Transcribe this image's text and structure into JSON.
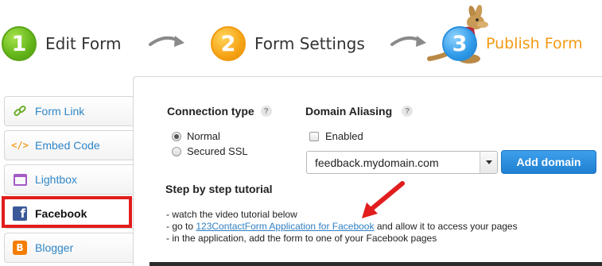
{
  "steps": [
    {
      "number": "1",
      "label": "Edit Form"
    },
    {
      "number": "2",
      "label": "Form Settings"
    },
    {
      "number": "3",
      "label": "Publish Form"
    }
  ],
  "sidebar": {
    "items": [
      {
        "label": "Form Link",
        "icon": "link-icon"
      },
      {
        "label": "Embed Code",
        "icon": "code-icon"
      },
      {
        "label": "Lightbox",
        "icon": "lightbox-icon"
      },
      {
        "label": "Facebook",
        "icon": "facebook-icon"
      },
      {
        "label": "Blogger",
        "icon": "blogger-icon"
      }
    ],
    "active": "Facebook"
  },
  "connection": {
    "title": "Connection type",
    "help": "?",
    "options": [
      {
        "label": "Normal",
        "checked": true
      },
      {
        "label": "Secured SSL",
        "checked": false
      }
    ]
  },
  "domain_aliasing": {
    "title": "Domain Aliasing",
    "help": "?",
    "enabled_label": "Enabled",
    "domain_value": "feedback.mydomain.com",
    "add_button": "Add domain"
  },
  "tutorial": {
    "title": "Step by step tutorial",
    "line1": "- watch the video tutorial below",
    "line2_prefix": "- go to ",
    "line2_link": "123ContactForm Application for Facebook",
    "line2_suffix": " and allow it to access your pages",
    "line3": "- in the application, add the form to one of your Facebook pages"
  },
  "colors": {
    "accent_orange": "#f39a12",
    "link_blue": "#2f86c7",
    "highlight_red": "#e11d1d",
    "button_blue": "#2a8ee0",
    "facebook_blue": "#3b5998"
  }
}
